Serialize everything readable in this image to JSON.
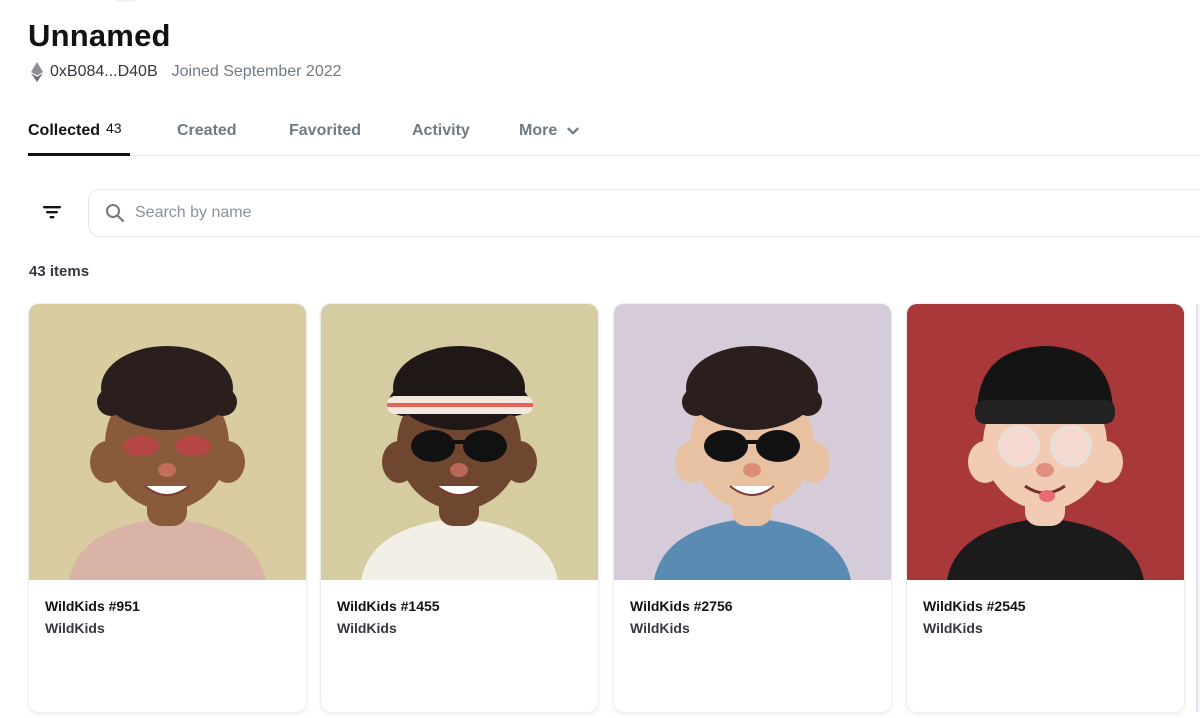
{
  "profile": {
    "name": "Unnamed",
    "address": "0xB084...D40B",
    "joined": "Joined September 2022",
    "chain_icon": "ethereum-icon"
  },
  "tabs": [
    {
      "label": "Collected",
      "count": "43",
      "active": true
    },
    {
      "label": "Created"
    },
    {
      "label": "Favorited"
    },
    {
      "label": "Activity"
    },
    {
      "label": "More",
      "icon": "chevron-down-icon"
    }
  ],
  "search": {
    "placeholder": "Search by name",
    "value": ""
  },
  "items_count": "43 items",
  "cards": [
    {
      "title": "WildKids #951",
      "collection": "WildKids",
      "bg": "#d8cca0",
      "skin": "#8a5a3c",
      "hair": "#2a1f1c"
    },
    {
      "title": "WildKids #1455",
      "collection": "WildKids",
      "bg": "#d6cca2",
      "skin": "#6f4630",
      "hair": "#1f1816"
    },
    {
      "title": "WildKids #2756",
      "collection": "WildKids",
      "bg": "#d6cbd9",
      "skin": "#e8c1a2",
      "hair": "#2a1f1c"
    },
    {
      "title": "WildKids #2545",
      "collection": "WildKids",
      "bg": "#a8383a",
      "skin": "#f1cbb3",
      "hair": "#141414"
    }
  ],
  "colors": {
    "text": "#04111d",
    "muted": "#707a83",
    "border": "#e5e8eb"
  }
}
